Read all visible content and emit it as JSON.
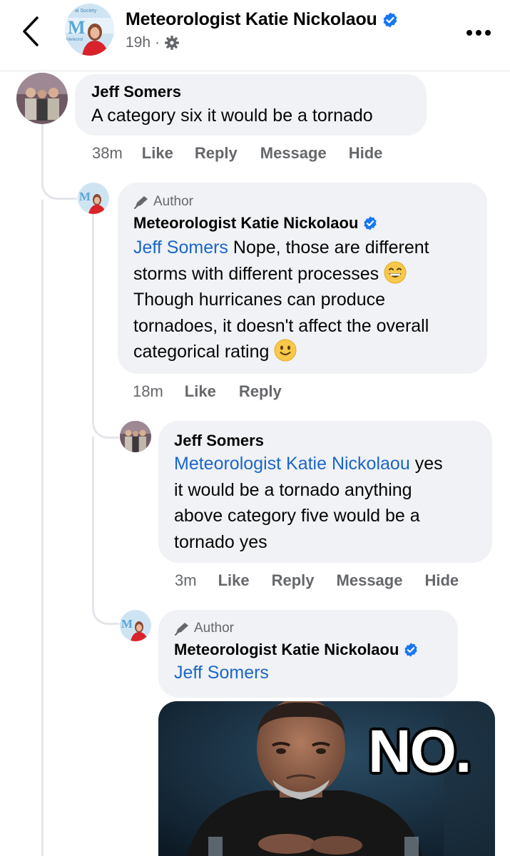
{
  "header": {
    "name": "Meteorologist Katie Nickolaou",
    "time": "19h",
    "separator": "·",
    "avatar_text": "M",
    "avatar_subtext": "al Society",
    "avatar_subtext2": "Meteorol"
  },
  "comments": [
    {
      "author": "Jeff Somers",
      "text": "A category six it would be a tornado",
      "time": "38m",
      "actions": [
        "Like",
        "Reply",
        "Message",
        "Hide"
      ]
    },
    {
      "author_tag": "Author",
      "author": "Meteorologist Katie Nickolaou",
      "mention": "Jeff Somers",
      "lines": [
        "Nope, those are different",
        "storms with different processes",
        "Though hurricanes can produce",
        "tornadoes, it doesn't affect the overall",
        "categorical rating"
      ],
      "emojis": [
        "grinning-face",
        "slightly-smiling-face"
      ],
      "time": "18m",
      "actions": [
        "Like",
        "Reply"
      ]
    },
    {
      "author": "Jeff Somers",
      "mention": "Meteorologist Katie Nickolaou",
      "lines": [
        "yes",
        "it would be a tornado anything",
        "above category five would be a",
        "tornado yes"
      ],
      "time": "3m",
      "actions": [
        "Like",
        "Reply",
        "Message",
        "Hide"
      ]
    },
    {
      "author_tag": "Author",
      "author": "Meteorologist Katie Nickolaou",
      "mention": "Jeff Somers",
      "meme_text": "NO."
    }
  ],
  "colors": {
    "verified": "#1877f2",
    "mention": "#1b66c9",
    "bubble": "#f0f2f5",
    "secondary_text": "#65676b"
  },
  "icons": [
    "back-chevron-icon",
    "verified-badge-icon",
    "settings-gear-icon",
    "more-dots-icon",
    "pencil-icon"
  ]
}
